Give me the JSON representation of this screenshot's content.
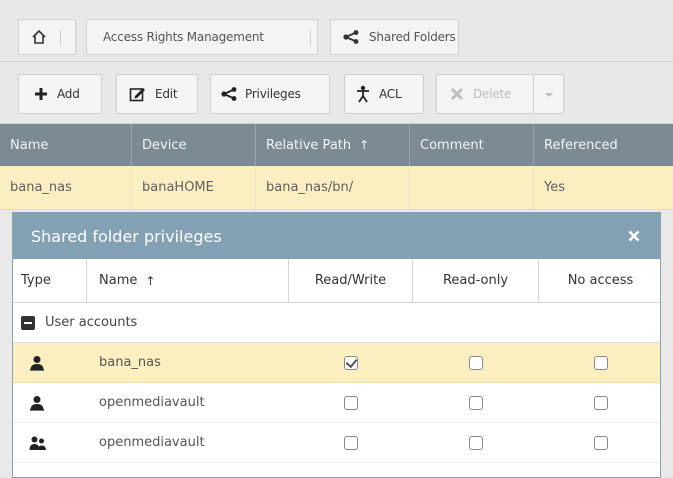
{
  "breadcrumb": {
    "home_icon": "home-icon",
    "items": [
      "Access Rights Management",
      "Shared Folders"
    ],
    "share_icon": "share-icon"
  },
  "toolbar": {
    "add": "Add",
    "edit": "Edit",
    "privileges": "Privileges",
    "acl": "ACL",
    "delete": "Delete"
  },
  "grid": {
    "columns": [
      "Name",
      "Device",
      "Relative Path",
      "Comment",
      "Referenced"
    ],
    "sort_indicator": "↑",
    "rows": [
      {
        "name": "bana_nas",
        "device": "banaHOME",
        "path": "bana_nas/bn/",
        "comment": "",
        "referenced": "Yes"
      }
    ]
  },
  "dialog": {
    "title": "Shared folder privileges",
    "columns": [
      "Type",
      "Name",
      "Read/Write",
      "Read-only",
      "No access"
    ],
    "sort_indicator": "↑",
    "group": "User accounts",
    "rows": [
      {
        "type": "user",
        "name": "bana_nas",
        "read_write": true,
        "read_only": false,
        "no_access": false,
        "selected": true
      },
      {
        "type": "user",
        "name": "openmediavault",
        "read_write": false,
        "read_only": false,
        "no_access": false,
        "selected": false
      },
      {
        "type": "group",
        "name": "openmediavault",
        "read_write": false,
        "read_only": false,
        "no_access": false,
        "selected": false
      }
    ]
  },
  "colors": {
    "grid_header": "#7c8a93",
    "dialog_title": "#83a0b4",
    "selected_row": "#fbeec1"
  }
}
